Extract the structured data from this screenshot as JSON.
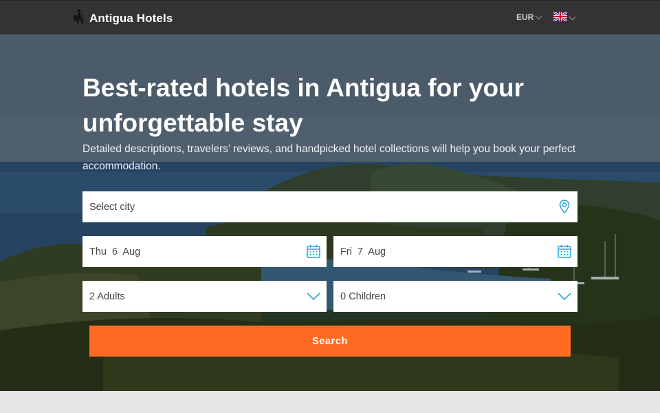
{
  "header": {
    "brand_name": "Antigua Hotels",
    "currency": "EUR",
    "language_flag": "uk-flag-icon"
  },
  "hero": {
    "headline": "Best-rated hotels in Antigua for your unforgettable stay",
    "subline": "Detailed descriptions, travelers’ reviews, and handpicked hotel collections will help you book your perfect accommodation."
  },
  "form": {
    "city_placeholder": "Select city",
    "checkin": "Thu  6  Aug",
    "checkout": "Fri  7  Aug",
    "adults": "2 Adults",
    "children": "0 Children",
    "search_label": "Search"
  },
  "colors": {
    "accent": "#ff6b22",
    "icon": "#29a3d9",
    "topbar": "#333333"
  }
}
